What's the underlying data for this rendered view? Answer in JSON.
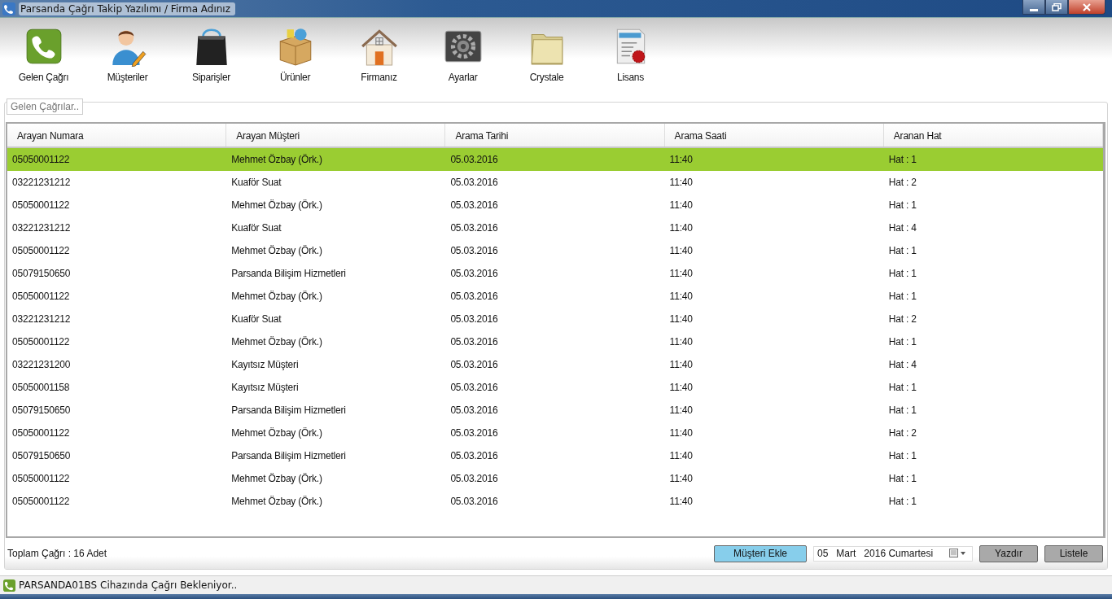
{
  "window": {
    "title": "Parsanda Çağrı Takip Yazılımı / Firma Adınız"
  },
  "toolbar": [
    {
      "label": "Gelen Çağrı"
    },
    {
      "label": "Müşteriler"
    },
    {
      "label": "Siparişler"
    },
    {
      "label": "Ürünler"
    },
    {
      "label": "Firmanız"
    },
    {
      "label": "Ayarlar"
    },
    {
      "label": "Crystale"
    },
    {
      "label": "Lisans"
    }
  ],
  "group": {
    "title": "Gelen Çağrılar.."
  },
  "table": {
    "columns": [
      "Arayan Numara",
      "Arayan Müşteri",
      "Arama Tarihi",
      "Arama Saati",
      "Aranan Hat"
    ],
    "rows": [
      {
        "cells": [
          "05050001122",
          "Mehmet Özbay (Örk.)",
          "05.03.2016",
          "11:40",
          "Hat : 1"
        ],
        "selected": true
      },
      {
        "cells": [
          "03221231212",
          "Kuaför Suat",
          "05.03.2016",
          "11:40",
          "Hat : 2"
        ],
        "selected": false
      },
      {
        "cells": [
          "05050001122",
          "Mehmet Özbay (Örk.)",
          "05.03.2016",
          "11:40",
          "Hat : 1"
        ],
        "selected": false
      },
      {
        "cells": [
          "03221231212",
          "Kuaför Suat",
          "05.03.2016",
          "11:40",
          "Hat : 4"
        ],
        "selected": false
      },
      {
        "cells": [
          "05050001122",
          "Mehmet Özbay (Örk.)",
          "05.03.2016",
          "11:40",
          "Hat : 1"
        ],
        "selected": false
      },
      {
        "cells": [
          "05079150650",
          "Parsanda Bilişim Hizmetleri",
          "05.03.2016",
          "11:40",
          "Hat : 1"
        ],
        "selected": false
      },
      {
        "cells": [
          "05050001122",
          "Mehmet Özbay (Örk.)",
          "05.03.2016",
          "11:40",
          "Hat : 1"
        ],
        "selected": false
      },
      {
        "cells": [
          "03221231212",
          "Kuaför Suat",
          "05.03.2016",
          "11:40",
          "Hat : 2"
        ],
        "selected": false
      },
      {
        "cells": [
          "05050001122",
          "Mehmet Özbay (Örk.)",
          "05.03.2016",
          "11:40",
          "Hat : 1"
        ],
        "selected": false
      },
      {
        "cells": [
          "03221231200",
          "Kayıtsız Müşteri",
          "05.03.2016",
          "11:40",
          "Hat : 4"
        ],
        "selected": false
      },
      {
        "cells": [
          "05050001158",
          "Kayıtsız Müşteri",
          "05.03.2016",
          "11:40",
          "Hat : 1"
        ],
        "selected": false
      },
      {
        "cells": [
          "05079150650",
          "Parsanda Bilişim Hizmetleri",
          "05.03.2016",
          "11:40",
          "Hat : 1"
        ],
        "selected": false
      },
      {
        "cells": [
          "05050001122",
          "Mehmet Özbay (Örk.)",
          "05.03.2016",
          "11:40",
          "Hat : 2"
        ],
        "selected": false
      },
      {
        "cells": [
          "05079150650",
          "Parsanda Bilişim Hizmetleri",
          "05.03.2016",
          "11:40",
          "Hat : 1"
        ],
        "selected": false
      },
      {
        "cells": [
          "05050001122",
          "Mehmet Özbay (Örk.)",
          "05.03.2016",
          "11:40",
          "Hat : 1"
        ],
        "selected": false
      },
      {
        "cells": [
          "05050001122",
          "Mehmet Özbay (Örk.)",
          "05.03.2016",
          "11:40",
          "Hat : 1"
        ],
        "selected": false
      }
    ]
  },
  "footer": {
    "total": "Toplam Çağrı : 16 Adet",
    "add_button": "Müşteri Ekle",
    "date": {
      "day": "05",
      "month": "Mart",
      "year_day": "2016 Cumartesi"
    },
    "print_button": "Yazdır",
    "list_button": "Listele"
  },
  "status_bar": {
    "text": "PARSANDA01BS Cihazında Çağrı Bekleniyor.."
  }
}
